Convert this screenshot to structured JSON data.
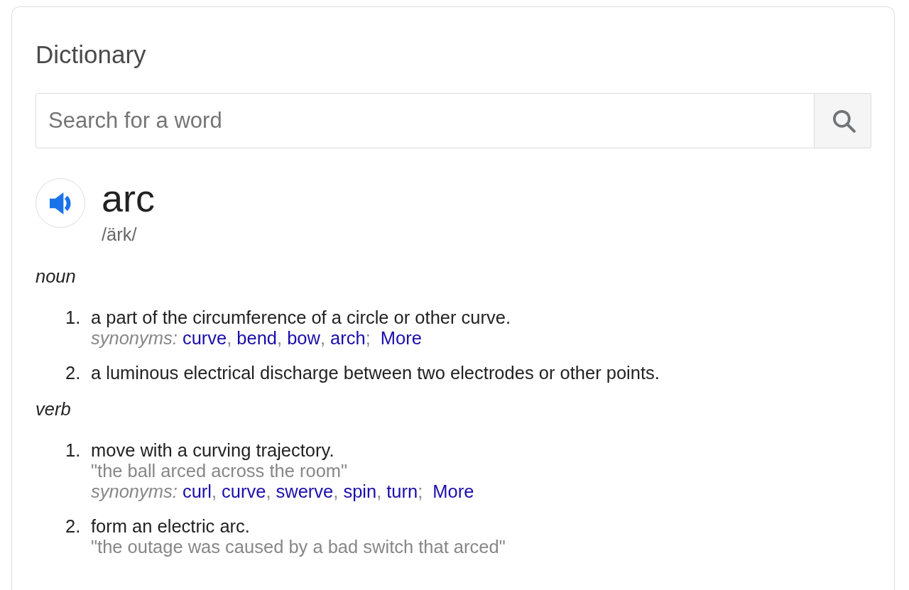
{
  "title": "Dictionary",
  "search": {
    "placeholder": "Search for a word"
  },
  "entry": {
    "word": "arc",
    "pronunciation": "/ärk/"
  },
  "parts_of_speech": [
    {
      "label": "noun",
      "senses": [
        {
          "number": "1.",
          "definition": "a part of the circumference of a circle or other curve.",
          "synonyms_label": "synonyms:",
          "synonyms": [
            {
              "word": "curve",
              "separator": ","
            },
            {
              "word": "bend",
              "separator": ","
            },
            {
              "word": "bow",
              "separator": ","
            },
            {
              "word": "arch",
              "separator": ";"
            }
          ],
          "more": "More"
        },
        {
          "number": "2.",
          "definition": "a luminous electrical discharge between two electrodes or other points."
        }
      ]
    },
    {
      "label": "verb",
      "senses": [
        {
          "number": "1.",
          "definition": "move with a curving trajectory.",
          "example": "\"the ball arced across the room\"",
          "synonyms_label": "synonyms:",
          "synonyms": [
            {
              "word": "curl",
              "separator": ","
            },
            {
              "word": "curve",
              "separator": ","
            },
            {
              "word": "swerve",
              "separator": ","
            },
            {
              "word": "spin",
              "separator": ","
            },
            {
              "word": "turn",
              "separator": ";"
            }
          ],
          "more": "More"
        },
        {
          "number": "2.",
          "definition": "form an electric arc.",
          "example": "\"the outage was caused by a bad switch that arced\""
        }
      ]
    }
  ]
}
